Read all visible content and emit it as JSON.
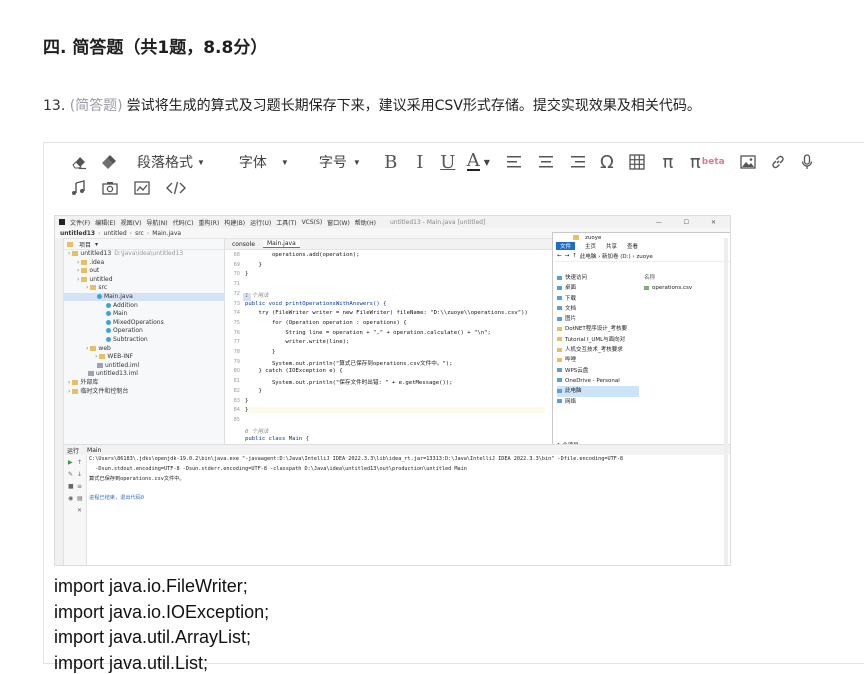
{
  "section": {
    "title": "四. 简答题（共1题，8.8分）"
  },
  "question": {
    "number": "13.",
    "type": "(简答题)",
    "text": "尝试将生成的算式及习题长期保存下来，建议采用CSV形式存储。提交实现效果及相关代码。"
  },
  "toolbar": {
    "paragraph_format": "段落格式",
    "font": "字体",
    "font_size": "字号",
    "bold": "B",
    "italic": "I",
    "underline": "U",
    "font_color": "A",
    "omega": "Ω",
    "pi": "π",
    "pi_beta": "π",
    "beta": "beta",
    "icons": [
      "eraser-icon",
      "format-painter-icon",
      "align-left-icon",
      "align-center-icon",
      "align-right-icon",
      "table-icon",
      "image-icon",
      "link-icon",
      "microphone-icon",
      "music-icon",
      "camera-icon",
      "chart-icon",
      "code-icon"
    ]
  },
  "screenshot": {
    "menu": [
      "文件(F)",
      "编辑(E)",
      "视图(V)",
      "导航(N)",
      "代码(C)",
      "重构(R)",
      "构建(B)",
      "运行(U)",
      "工具(T)",
      "VCS(S)",
      "窗口(W)",
      "帮助(H)"
    ],
    "window_title": "untitled13 - Main.java [untitled]",
    "window_controls": "—  ☐  ✕",
    "breadcrumb": [
      "untitled13",
      "untitled",
      "src",
      "Main.java"
    ],
    "project_label": "项目",
    "project_tree": [
      {
        "label": "untitled13",
        "note": "D:\\Java\\idea\\untitled13",
        "indent": 0,
        "type": "folder"
      },
      {
        "label": ".idea",
        "indent": 1,
        "type": "folder"
      },
      {
        "label": "out",
        "indent": 1,
        "type": "folder"
      },
      {
        "label": "untitled",
        "indent": 1,
        "type": "folder"
      },
      {
        "label": "src",
        "indent": 2,
        "type": "folder"
      },
      {
        "label": "Main.java",
        "indent": 3,
        "type": "class",
        "selected": true
      },
      {
        "label": "Addition",
        "indent": 4,
        "type": "class"
      },
      {
        "label": "Main",
        "indent": 4,
        "type": "class"
      },
      {
        "label": "MixedOperations",
        "indent": 4,
        "type": "class"
      },
      {
        "label": "Operation",
        "indent": 4,
        "type": "class"
      },
      {
        "label": "Subtraction",
        "indent": 4,
        "type": "class"
      },
      {
        "label": "web",
        "indent": 2,
        "type": "folder"
      },
      {
        "label": "WEB-INF",
        "indent": 3,
        "type": "folder"
      },
      {
        "label": "untitled.iml",
        "indent": 3,
        "type": "file"
      },
      {
        "label": "untitled13.iml",
        "indent": 2,
        "type": "file"
      },
      {
        "label": "外部库",
        "indent": 0,
        "type": "folder"
      },
      {
        "label": "临时文件和控制台",
        "indent": 0,
        "type": "folder"
      }
    ],
    "editor_tabs": [
      "console",
      "Main.java"
    ],
    "line_numbers": [
      "68",
      "69",
      "70",
      "71",
      "72",
      "73",
      "74",
      "75",
      "76",
      "77",
      "78",
      "79",
      "80",
      "81",
      "82",
      "83",
      "84",
      "85"
    ],
    "code_lines": [
      {
        "text": "        operations.add(operation);",
        "cls": ""
      },
      {
        "text": "    }",
        "cls": ""
      },
      {
        "text": "}",
        "cls": ""
      },
      {
        "text": "",
        "cls": ""
      },
      {
        "text": "1 个用法",
        "cls": "cm"
      },
      {
        "text": "public void printOperationsWithAnswers() {",
        "cls": "kw"
      },
      {
        "text": "    try (FileWriter writer = new FileWriter( fileName: \"D:\\\\zuoye\\\\operations.csv\"))",
        "cls": ""
      },
      {
        "text": "        for (Operation operation : operations) {",
        "cls": ""
      },
      {
        "text": "            String line = operation + \",\" + operation.calculate() + \"\\n\";",
        "cls": ""
      },
      {
        "text": "            writer.write(line);",
        "cls": ""
      },
      {
        "text": "        }",
        "cls": ""
      },
      {
        "text": "        System.out.println(\"算式已保存到operations.csv文件中。\");",
        "cls": ""
      },
      {
        "text": "    } catch (IOException e) {",
        "cls": ""
      },
      {
        "text": "        System.out.println(\"保存文件时出错: \" + e.getMessage());",
        "cls": ""
      },
      {
        "text": "    }",
        "cls": ""
      },
      {
        "text": "}",
        "cls": ""
      },
      {
        "text": "}",
        "cls": "hl"
      },
      {
        "text": "",
        "cls": ""
      },
      {
        "text": "0 个用法",
        "cls": "cm"
      },
      {
        "text": "public class Main {",
        "cls": "kw"
      }
    ],
    "explorer": {
      "title": "zuoye",
      "ribbon": [
        "文件",
        "主页",
        "共享",
        "查看"
      ],
      "address": "此电脑 › 新加卷 (D:) › zuoye",
      "nav": [
        {
          "label": "快速访问",
          "type": "q"
        },
        {
          "label": "桌面",
          "type": "q"
        },
        {
          "label": "下载",
          "type": "q"
        },
        {
          "label": "文档",
          "type": "q"
        },
        {
          "label": "图片",
          "type": "q"
        },
        {
          "label": "DotNET程序设计_考核要",
          "type": "f"
        },
        {
          "label": "Tutorial I_UML与面向对",
          "type": "f"
        },
        {
          "label": "人机交互技术_考核要求",
          "type": "f"
        },
        {
          "label": "哔哩",
          "type": "f"
        },
        {
          "label": "WPS云盘",
          "type": "q"
        },
        {
          "label": "OneDrive - Personal",
          "type": "q"
        },
        {
          "label": "此电脑",
          "type": "q",
          "selected": true
        },
        {
          "label": "网络",
          "type": "q"
        }
      ],
      "column": "名称",
      "files": [
        "operations.csv"
      ],
      "status": "1 个项目"
    },
    "run_tabs": [
      "运行",
      "Main"
    ],
    "console_lines": [
      {
        "text": "C:\\Users\\86183\\.jdks\\openjdk-19.0.2\\bin\\java.exe \"-javaagent:D:\\Java\\IntelliJ IDEA 2022.3.3\\lib\\idea_rt.jar=13313:D:\\Java\\IntelliJ IDEA 2022.3.3\\bin\" -Dfile.encoding=UTF-8",
        "cls": ""
      },
      {
        "text": "  -Dsun.stdout.encoding=UTF-8 -Dsun.stderr.encoding=UTF-8 -classpath D:\\Java\\idea\\untitled13\\out\\production\\untitled Main",
        "cls": ""
      },
      {
        "text": "算式已保存到operations.csv文件中。",
        "cls": ""
      },
      {
        "text": "",
        "cls": ""
      },
      {
        "text": "进程已结束，退出代码0",
        "cls": "exit"
      }
    ]
  },
  "code_text": [
    "import java.io.FileWriter;",
    "import java.io.IOException;",
    "import java.util.ArrayList;",
    "import java.util.List;"
  ]
}
